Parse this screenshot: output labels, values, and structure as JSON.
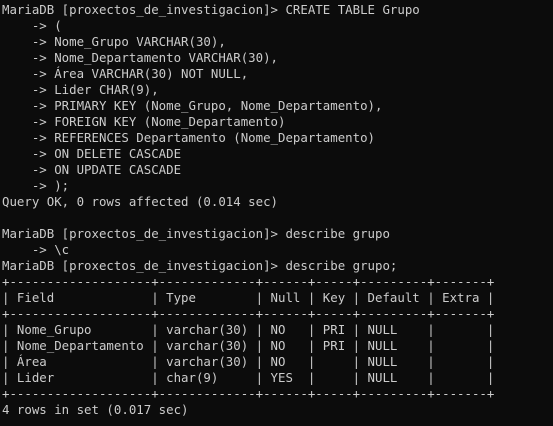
{
  "terminal": {
    "lines": [
      "MariaDB [proxectos_de_investigacion]> CREATE TABLE Grupo",
      "    -> (",
      "    -> Nome_Grupo VARCHAR(30),",
      "    -> Nome_Departamento VARCHAR(30),",
      "    -> Área VARCHAR(30) NOT NULL,",
      "    -> Lider CHAR(9),",
      "    -> PRIMARY KEY (Nome_Grupo, Nome_Departamento),",
      "    -> FOREIGN KEY (Nome_Departamento)",
      "    -> REFERENCES Departamento (Nome_Departamento)",
      "    -> ON DELETE CASCADE",
      "    -> ON UPDATE CASCADE",
      "    -> );",
      "Query OK, 0 rows affected (0.014 sec)",
      "",
      "MariaDB [proxectos_de_investigacion]> describe grupo",
      "    -> \\c",
      "MariaDB [proxectos_de_investigacion]> describe grupo;",
      "+-------------------+-------------+------+-----+---------+-------+",
      "| Field             | Type        | Null | Key | Default | Extra |",
      "+-------------------+-------------+------+-----+---------+-------+",
      "| Nome_Grupo        | varchar(30) | NO   | PRI | NULL    |       |",
      "| Nome_Departamento | varchar(30) | NO   | PRI | NULL    |       |",
      "| Área              | varchar(30) | NO   |     | NULL    |       |",
      "| Lider             | char(9)     | YES  |     | NULL    |       |",
      "+-------------------+-------------+------+-----+---------+-------+",
      "4 rows in set (0.017 sec)"
    ]
  },
  "colors": {
    "background": "#0c0c0c",
    "foreground": "#cccccc"
  }
}
